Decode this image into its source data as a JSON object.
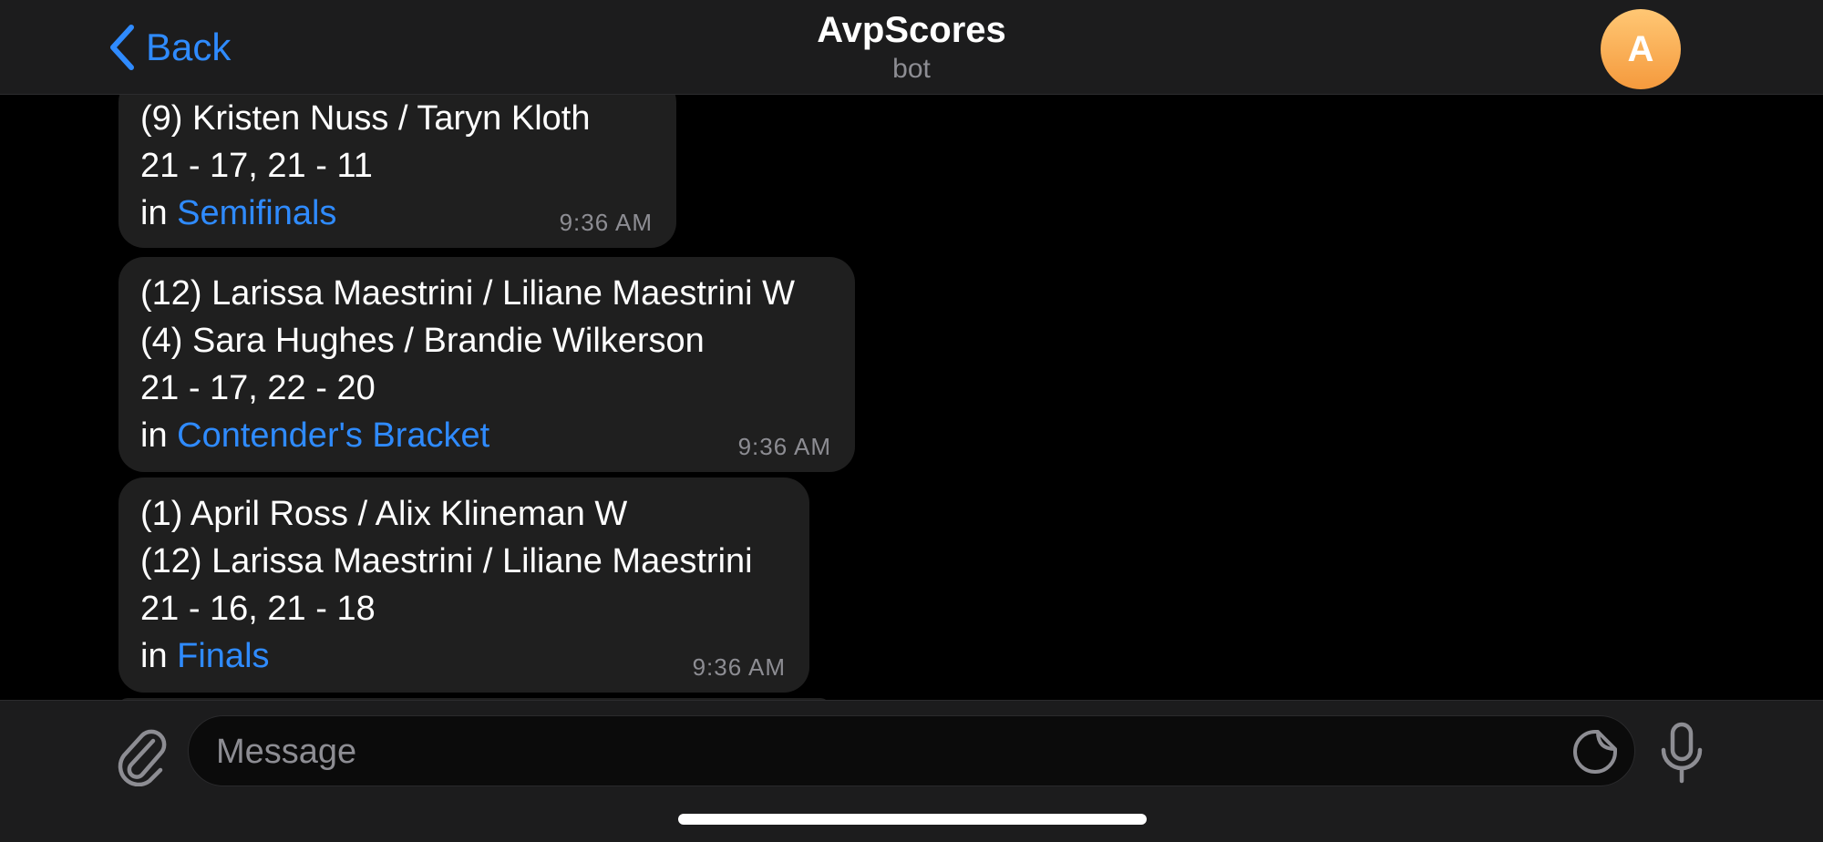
{
  "header": {
    "back_label": "Back",
    "title": "AvpScores",
    "subtitle": "bot",
    "avatar_letter": "A",
    "accent_color": "#2f8bff"
  },
  "messages": [
    {
      "lines": [
        "(9) Kristen Nuss / Taryn Kloth",
        "21 - 17, 21 - 11"
      ],
      "prefix": "in ",
      "link": "Semifinals",
      "time": "9:36 AM"
    },
    {
      "lines": [
        "(12) Larissa Maestrini / Liliane Maestrini W",
        "(4) Sara Hughes / Brandie Wilkerson",
        "21 - 17, 22 - 20"
      ],
      "prefix": "in ",
      "link": "Contender's Bracket",
      "time": "9:36 AM"
    },
    {
      "lines": [
        "(1) April Ross / Alix Klineman W",
        "(12) Larissa Maestrini / Liliane Maestrini",
        "21 - 16, 21 - 18"
      ],
      "prefix": "in ",
      "link": "Finals",
      "time": "9:36 AM"
    }
  ],
  "composer": {
    "placeholder": "Message",
    "icons": {
      "attach": "paperclip-icon",
      "sticker": "sticker-icon",
      "mic": "microphone-icon",
      "scroll": "chevron-down-icon"
    }
  }
}
